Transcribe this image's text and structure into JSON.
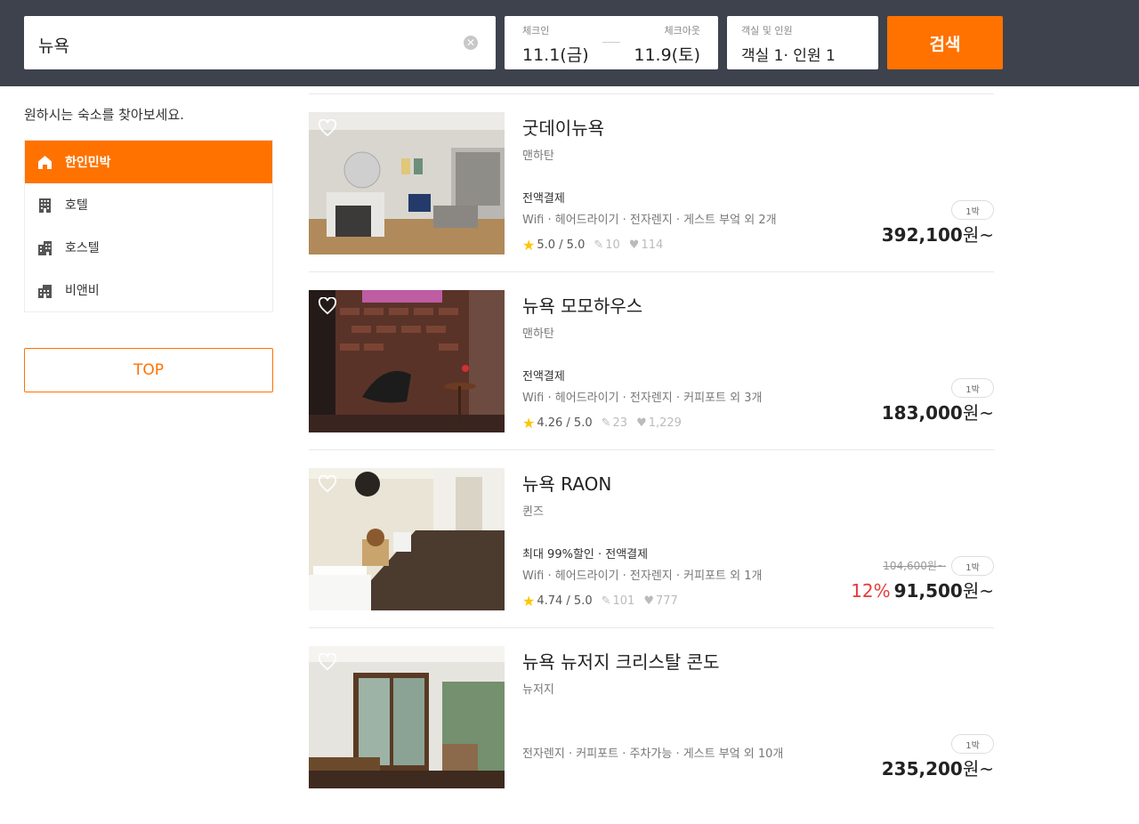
{
  "header": {
    "search_query": "뉴욕",
    "checkin_label": "체크인",
    "checkin_value": "11.1(금)",
    "checkout_label": "체크아웃",
    "checkout_value": "11.9(토)",
    "guests_label": "객실 및 인원",
    "guests_value": "객실 1· 인원 1",
    "search_button": "검색",
    "accent_color": "#ff7200",
    "bg_color": "#3d424d"
  },
  "sidebar": {
    "hint": "원하시는 숙소를 찾아보세요.",
    "categories": [
      {
        "label": "한인민박",
        "icon": "home-icon",
        "active": true
      },
      {
        "label": "호텔",
        "icon": "building-icon",
        "active": false
      },
      {
        "label": "호스텔",
        "icon": "city-building-icon",
        "active": false
      },
      {
        "label": "비앤비",
        "icon": "house-building-icon",
        "active": false
      }
    ],
    "top_button": "TOP"
  },
  "listings": [
    {
      "name": "굿데이뉴욕",
      "region": "맨하탄",
      "badges": "전액결제",
      "amenities": "Wifi · 헤어드라이기 · 전자렌지 · 게스트 부엌 외 2개",
      "rating": "5.0 / 5.0",
      "reviews": "10",
      "likes": "114",
      "nights": "1박",
      "original_price": "",
      "discount": "",
      "price": "392,100",
      "price_suffix": "원~"
    },
    {
      "name": "뉴욕 모모하우스",
      "region": "맨하탄",
      "badges": "전액결제",
      "amenities": "Wifi · 헤어드라이기 · 전자렌지 · 커피포트 외 3개",
      "rating": "4.26 / 5.0",
      "reviews": "23",
      "likes": "1,229",
      "nights": "1박",
      "original_price": "",
      "discount": "",
      "price": "183,000",
      "price_suffix": "원~"
    },
    {
      "name": "뉴욕 RAON",
      "region": "퀸즈",
      "badges": "최대 99%할인 · 전액결제",
      "amenities": "Wifi · 헤어드라이기 · 전자렌지 · 커피포트 외 1개",
      "rating": "4.74 / 5.0",
      "reviews": "101",
      "likes": "777",
      "nights": "1박",
      "original_price": "104,600원~",
      "discount": "12%",
      "price": "91,500",
      "price_suffix": "원~"
    },
    {
      "name": "뉴욕 뉴저지 크리스탈 콘도",
      "region": "뉴저지",
      "badges": "",
      "amenities": "전자렌지 · 커피포트 · 주차가능 · 게스트 부엌 외 10개",
      "rating": "",
      "reviews": "",
      "likes": "",
      "nights": "1박",
      "original_price": "",
      "discount": "",
      "price": "235,200",
      "price_suffix": "원~"
    }
  ]
}
